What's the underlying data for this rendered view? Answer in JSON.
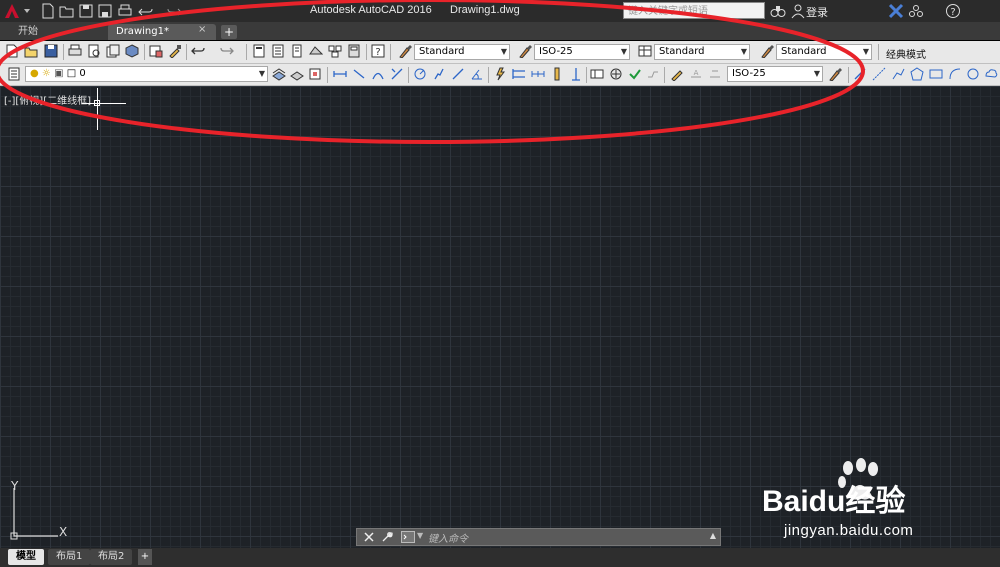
{
  "title_bar": {
    "app_title": "Autodesk AutoCAD 2016",
    "file_name": "Drawing1.dwg",
    "search_placeholder": "键入关键字或短语",
    "login_label": "登录",
    "icons": [
      "autocad-logo-icon",
      "new-icon",
      "open-icon",
      "save-icon",
      "save-as-icon",
      "print-icon",
      "undo-icon",
      "redo-icon",
      "find-binoculars-icon",
      "user-icon",
      "exchange-icon",
      "a360-icon",
      "help-icon"
    ]
  },
  "file_tabs": {
    "start_label": "开始",
    "active_label": "Drawing1*",
    "close_glyph": "×",
    "add_glyph": "+"
  },
  "toolbar_standard": {
    "text_style": "Standard",
    "dim_style": "ISO-25",
    "table_style": "Standard",
    "multileader_style": "Standard",
    "workspace": "经典模式"
  },
  "toolbar_layers": {
    "current_layer": "0",
    "dim_style_2": "ISO-25"
  },
  "viewport": {
    "label": "[-][俯视][二维线框]",
    "ucs_y": "Y",
    "ucs_x": "X"
  },
  "command_line": {
    "placeholder": "键入命令"
  },
  "layout_tabs": {
    "model": "模型",
    "layout1": "布局1",
    "layout2": "布局2",
    "add": "+"
  },
  "watermark": {
    "brand": "Baidu经验",
    "url": "jingyan.baidu.com"
  },
  "colors": {
    "annotation_red": "#e8232a",
    "canvas_bg": "#1e2227",
    "ribbon_bg": "#e8e8e8"
  }
}
